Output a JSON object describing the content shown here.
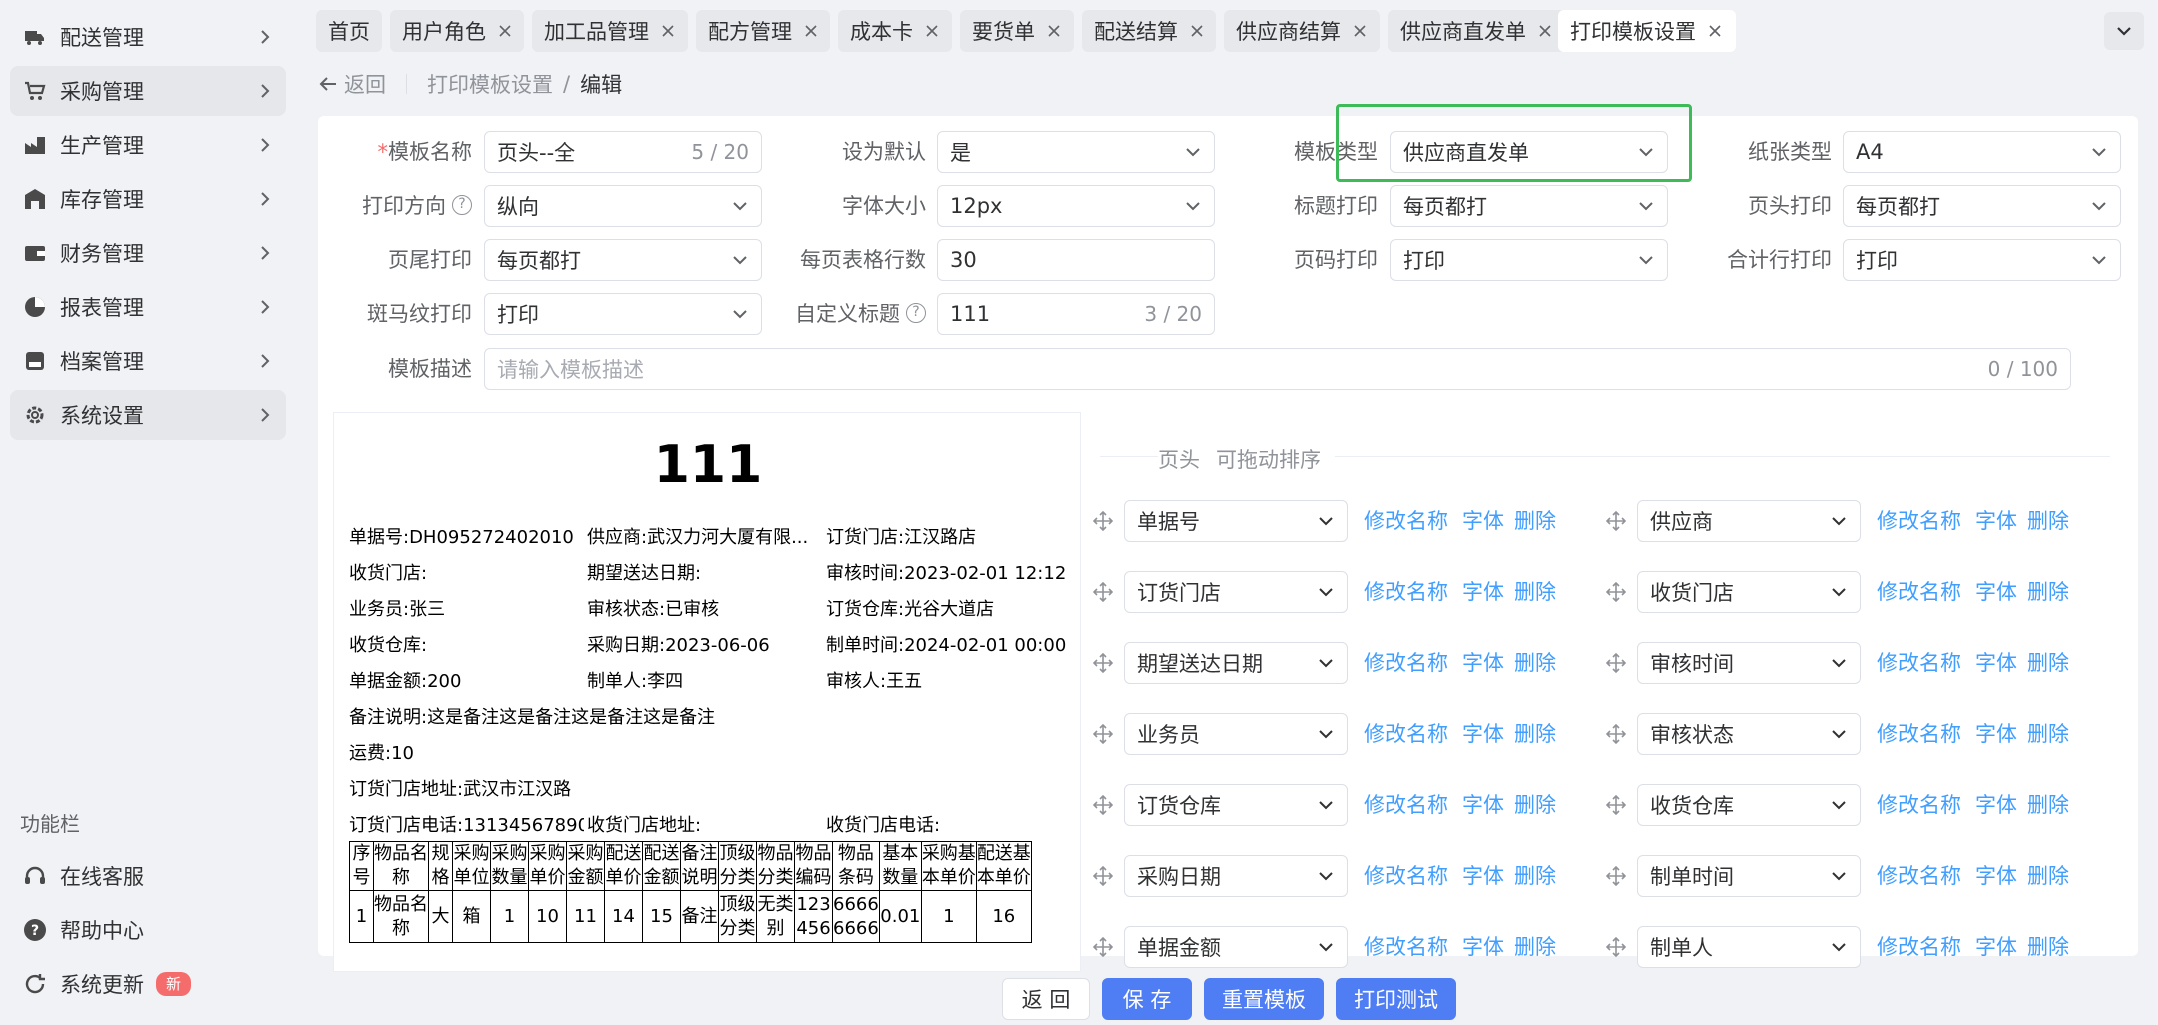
{
  "sidebar": {
    "menu": [
      {
        "label": "配送管理",
        "icon": "truck-icon"
      },
      {
        "label": "采购管理",
        "icon": "cart-icon"
      },
      {
        "label": "生产管理",
        "icon": "factory-icon"
      },
      {
        "label": "库存管理",
        "icon": "warehouse-icon"
      },
      {
        "label": "财务管理",
        "icon": "wallet-icon"
      },
      {
        "label": "报表管理",
        "icon": "pie-chart-icon"
      },
      {
        "label": "档案管理",
        "icon": "archive-icon"
      },
      {
        "label": "系统设置",
        "icon": "gear-icon"
      }
    ],
    "function_title": "功能栏",
    "functions": [
      {
        "label": "在线客服",
        "icon": "headset-icon"
      },
      {
        "label": "帮助中心",
        "icon": "help-icon"
      },
      {
        "label": "系统更新",
        "icon": "refresh-icon",
        "badge": "新"
      }
    ]
  },
  "tabs": [
    "首页",
    "用户角色",
    "加工品管理",
    "配方管理",
    "成本卡",
    "要货单",
    "配送结算",
    "供应商结算",
    "供应商直发单",
    "打印模板设置"
  ],
  "breadcrumb": {
    "back": "返回",
    "parent": "打印模板设置",
    "sep": "/",
    "current": "编辑"
  },
  "form": {
    "template_name": {
      "label": "模板名称",
      "required": "*",
      "value": "页头--全",
      "count": "5 / 20"
    },
    "set_default": {
      "label": "设为默认",
      "value": "是"
    },
    "template_type": {
      "label": "模板类型",
      "value": "供应商直发单"
    },
    "paper_type": {
      "label": "纸张类型",
      "value": "A4"
    },
    "print_direction": {
      "label": "打印方向",
      "help": "?",
      "value": "纵向"
    },
    "font_size": {
      "label": "字体大小",
      "value": "12px"
    },
    "title_print": {
      "label": "标题打印",
      "value": "每页都打"
    },
    "header_print": {
      "label": "页头打印",
      "value": "每页都打"
    },
    "footer_print": {
      "label": "页尾打印",
      "value": "每页都打"
    },
    "rows_per_page": {
      "label": "每页表格行数",
      "value": "30"
    },
    "page_num_print": {
      "label": "页码打印",
      "value": "打印"
    },
    "total_row_print": {
      "label": "合计行打印",
      "value": "打印"
    },
    "zebra_print": {
      "label": "斑马纹打印",
      "value": "打印"
    },
    "custom_title": {
      "label": "自定义标题",
      "help": "?",
      "value": "111",
      "count": "3 / 20"
    },
    "description": {
      "label": "模板描述",
      "placeholder": "请输入模板描述",
      "count": "0 / 100"
    }
  },
  "preview": {
    "title": "111",
    "lines": [
      [
        "单据号:DH0952724020100...",
        "供应商:武汉力河大厦有限...",
        "订货门店:江汉路店"
      ],
      [
        "收货门店:",
        "期望送达日期:",
        "审核时间:2023-02-01 12:12..."
      ],
      [
        "业务员:张三",
        "审核状态:已审核",
        "订货仓库:光谷大道店"
      ],
      [
        "收货仓库:",
        "采购日期:2023-06-06",
        "制单时间:2024-02-01 00:00..."
      ],
      [
        "单据金额:200",
        "制单人:李四",
        "审核人:王五"
      ]
    ],
    "single_lines": [
      "备注说明:这是备注这是备注这是备注这是备注",
      "运费:10",
      "订货门店地址:武汉市江汉路"
    ],
    "last_line": [
      "订货门店电话:13134567890",
      "收货门店地址:",
      "收货门店电话:"
    ],
    "table": {
      "headers": [
        [
          "序",
          "号"
        ],
        [
          "物品名",
          "称"
        ],
        [
          "规",
          "格"
        ],
        [
          "采购",
          "单位"
        ],
        [
          "采购",
          "数量"
        ],
        [
          "采购",
          "单价"
        ],
        [
          "采购",
          "金额"
        ],
        [
          "配送",
          "单价"
        ],
        [
          "配送",
          "金额"
        ],
        [
          "备注",
          "说明"
        ],
        [
          "顶级",
          "分类"
        ],
        [
          "物品",
          "分类"
        ],
        [
          "物品",
          "编码"
        ],
        [
          "物品",
          "条码"
        ],
        [
          "基本",
          "数量"
        ],
        [
          "采购基",
          "本单价"
        ],
        [
          "配送基",
          "本单价"
        ]
      ],
      "row": [
        [
          "1"
        ],
        [
          "物品名",
          "称"
        ],
        [
          "大"
        ],
        [
          "箱"
        ],
        [
          "1"
        ],
        [
          "10"
        ],
        [
          "11"
        ],
        [
          "14"
        ],
        [
          "15"
        ],
        [
          "备注"
        ],
        [
          "顶级",
          "分类"
        ],
        [
          "无类",
          "别"
        ],
        [
          "123",
          "456"
        ],
        [
          "6666",
          "6666"
        ],
        [
          "0.01"
        ],
        [
          "1"
        ],
        [
          "16"
        ]
      ]
    }
  },
  "config": {
    "title": "页头",
    "subtitle": "可拖动排序",
    "actions": {
      "rename": "修改名称",
      "font": "字体",
      "delete": "删除"
    },
    "fields": [
      [
        "单据号",
        "供应商"
      ],
      [
        "订货门店",
        "收货门店"
      ],
      [
        "期望送达日期",
        "审核时间"
      ],
      [
        "业务员",
        "审核状态"
      ],
      [
        "订货仓库",
        "收货仓库"
      ],
      [
        "采购日期",
        "制单时间"
      ],
      [
        "单据金额",
        "制单人"
      ]
    ]
  },
  "footer": {
    "back": "返 回",
    "save": "保 存",
    "reset": "重置模板",
    "test": "打印测试"
  },
  "colors": {
    "primary": "#4f7df3",
    "link": "#409eff",
    "highlight": "#3dbb58",
    "danger": "#f56c6c"
  }
}
